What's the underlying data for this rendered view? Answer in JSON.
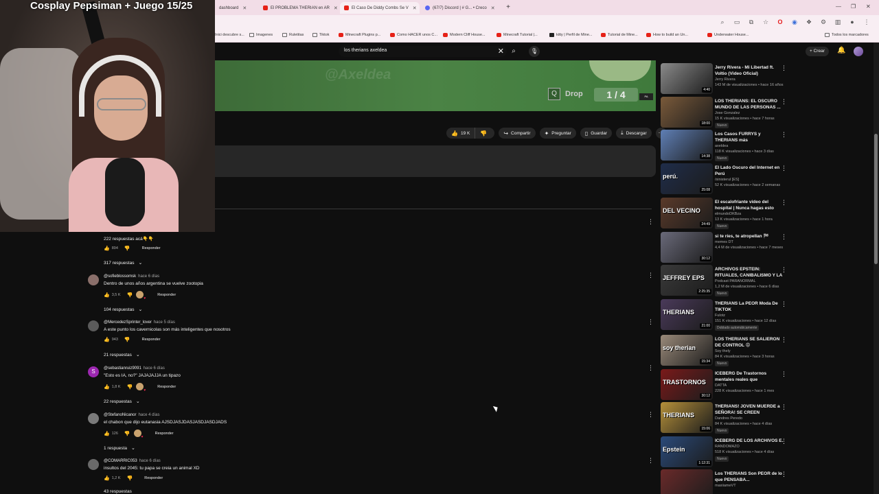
{
  "stream": {
    "overlay_title": "Cosplay Pepsiman + Juego 15/25"
  },
  "browser": {
    "tabs": [
      {
        "label": "dashboard",
        "favicon": "discord"
      },
      {
        "label": "El PROBLEMA THERIAN en AR",
        "favicon": "youtube"
      },
      {
        "label": "El Caso De Diddy Combs Se V",
        "favicon": "youtube"
      },
      {
        "label": "(67/7) Discord | # G... • Creco",
        "favicon": "discord"
      }
    ],
    "bookmarks": [
      "Inici descubre s...",
      "Imagenes",
      "Ruletitas",
      "Tiktok",
      "Minecraft Plugins p...",
      "Como HACER unos C...",
      "Modern Cliff House...",
      "Minecraft Tutorial |...",
      "kitty | Perfil de Mine...",
      "Tutorial de Mine...",
      "How to build an Un...",
      "Underwater House...",
      "Todos los marcadores"
    ]
  },
  "youtube": {
    "search_query": "los therians axeldea",
    "create_label": "Crear"
  },
  "player": {
    "watermark": "@Axeldea",
    "q_key": "Q",
    "drop_label": "Drop",
    "counter": "1 / 4"
  },
  "actions": {
    "likes": "19 K",
    "share": "Compartir",
    "ask": "Preguntar",
    "save": "Guardar",
    "download": "Descargar"
  },
  "comments": {
    "top_partial": {
      "text": "222 respuestas acá👇👇",
      "likes": "894",
      "reply": "Responder",
      "replies": "317 respuestas"
    },
    "items": [
      {
        "initial": "",
        "author": "@sofieblossomsk",
        "time": "hace 6 días",
        "text": "Dentro de unos años argentina se vuelve zootopia",
        "likes": "3,5 K",
        "reply": "Responder",
        "replies": "104 respuestas"
      },
      {
        "initial": "",
        "author": "@MercedezSprinter_lover",
        "time": "hace 5 días",
        "text": "A este punto los cavernicolas son más inteligentes que nosotros",
        "likes": "943",
        "reply": "Responder",
        "replies": "21 respuestas"
      },
      {
        "initial": "S",
        "author": "@sebastianruiz9091",
        "time": "hace 6 días",
        "text": "\"Esto es IA, no?\" JAJAJAJJA un tipazo",
        "likes": "1,8 K",
        "reply": "Responder",
        "replies": "22 respuestas"
      },
      {
        "initial": "",
        "author": "@StefanoNicanor",
        "time": "hace 4 días",
        "text": "el chabon que dijo eutanasia AJSDJASJDASJASDJASDJADS",
        "likes": "126",
        "reply": "Responder",
        "replies": "1 respuesta"
      },
      {
        "initial": "",
        "author": "@COMARRIC053",
        "time": "hace 6 días",
        "text": "insultos del 2045: tu papa se creia un animal XD",
        "likes": "1,2 K",
        "reply": "Responder",
        "replies": "43 respuestas"
      }
    ]
  },
  "sidebar": [
    {
      "title": "Jerry Rivera - Mi Libertad ft. Voltio (Video Oficial)",
      "channel": "Jerry Rivera",
      "meta": "143 M de visualizaciones • hace 16 años",
      "badge": "",
      "duration": "4:40",
      "thumb_text": "",
      "thumb_color": "#8a8a8a"
    },
    {
      "title": "LOS THERIANS: EL OSCURO MUNDO DE LAS PERSONAS ...",
      "channel": "Jose Gonzalez",
      "meta": "15 K visualizaciones • hace 7 horas",
      "badge": "Nuevo",
      "duration": "18:00",
      "thumb_text": "",
      "thumb_color": "#7a5a3a"
    },
    {
      "title": "Los Casos FURRYS y THERIANS más PERTURBADORES de ...",
      "channel": "axeldea",
      "meta": "118 K visualizaciones • hace 3 días",
      "badge": "Nuevo",
      "duration": "14:38",
      "thumb_text": "",
      "thumb_color": "#5f7fb5"
    },
    {
      "title": "El Lado Oscuro del Internet en Perú",
      "channel": "/sinisterul [ES]",
      "meta": "52 K visualizaciones • hace 2 semanas",
      "badge": "",
      "duration": "25:08",
      "thumb_text": "perú.",
      "thumb_color": "#1f2d4a"
    },
    {
      "title": "El escalofriante video del hospital | Nunca hagas esto",
      "channel": "elmundoDKBza",
      "meta": "13 K visualizaciones • hace 1 hora",
      "badge": "Nuevo",
      "duration": "24:49",
      "thumb_text": "DEL VECINO",
      "thumb_color": "#5a3a2a"
    },
    {
      "title": "si te ríes, te atropellan 🏁",
      "channel": "memes DT",
      "meta": "4,4 M de visualizaciones • hace 7 meses",
      "badge": "",
      "duration": "30:12",
      "thumb_text": "",
      "thumb_color": "#6a6a7a"
    },
    {
      "title": "ARCHIVOS EPSTEIN: RITUALES, CANIBALISMO Y LA VERDAD ...",
      "channel": "Podcast PARANORMAL",
      "meta": "1,2 M de visualizaciones • hace 6 días",
      "badge": "Nuevo",
      "duration": "2:25:35",
      "thumb_text": "JEFFREY EPS",
      "thumb_color": "#3a3a3a"
    },
    {
      "title": "THERIANS La PEOR Moda De TIKTOK",
      "channel": "Fulotz",
      "meta": "151 K visualizaciones • hace 12 días",
      "badge": "Doblado automáticamente",
      "duration": "21:00",
      "thumb_text": "THERIANS",
      "thumb_color": "#4a3a5a"
    },
    {
      "title": "LOS THERIANS SE SALIERON DE CONTROL 😡",
      "channel": "Soy thely",
      "meta": "84 K visualizaciones • hace 3 horas",
      "badge": "Nuevo",
      "duration": "15:34",
      "thumb_text": "soy therian",
      "thumb_color": "#9a8a7a"
    },
    {
      "title": "ICEBERG De Trastornos mentales reales que destruyen...",
      "channel": "DATTA",
      "meta": "228 K visualizaciones • hace 1 mes",
      "badge": "",
      "duration": "30:12",
      "thumb_text": "TRASTORNOS",
      "thumb_color": "#7a1a1a"
    },
    {
      "title": "THERIANS! JOVEN MUERDE a SEÑORA! SE CREEN ANIMALE...",
      "channel": "Dandres Peredo",
      "meta": "84 K visualizaciones • hace 4 días",
      "badge": "Nuevo",
      "duration": "15:06",
      "thumb_text": "THERIANS",
      "thumb_color": "#b5903a"
    },
    {
      "title": "ICEBERG DE LOS ARCHIVOS E.",
      "channel": "RANDOMAZO",
      "meta": "518 K visualizaciones • hace 4 días",
      "badge": "Nuevo",
      "duration": "1:12:31",
      "thumb_text": "Epstein",
      "thumb_color": "#2a4a7a"
    },
    {
      "title": "Los THERIANS Son PEOR de lo que PENSABA...",
      "channel": "maxiiameVT",
      "meta": "",
      "badge": "",
      "duration": "",
      "thumb_text": "",
      "thumb_color": "#6a2a2a"
    }
  ]
}
